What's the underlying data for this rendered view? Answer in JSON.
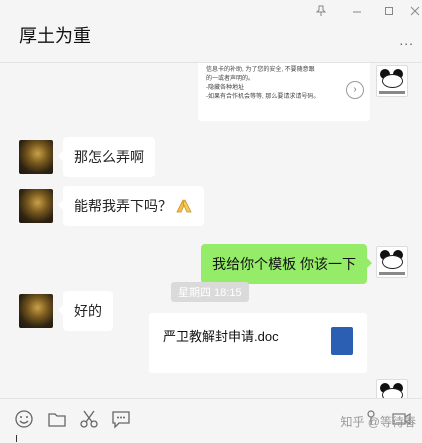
{
  "header": {
    "title": "厚土为重",
    "more_label": "..."
  },
  "messages": {
    "image_card_lines": [
      "信息卡的补助, 为了您的安全, 不要随意跟",
      "的一或者声明的。",
      "-隐藏各种地址",
      "-如果有合作机会等等, 那么要请求请号码。"
    ],
    "image_card_arrow": "›",
    "m1": "那怎么弄啊",
    "m2": "能帮我弄下吗？",
    "m3": "我给你个模板 你该一下",
    "m4": "好的",
    "timestamp": "星期四 18:15",
    "file_name": "严卫教解封申请.doc"
  },
  "toolbar": {
    "watermark": "知乎 @等待春"
  },
  "colors": {
    "sent_bubble": "#95ec69",
    "received_bubble": "#ffffff",
    "background": "#f5f5f5"
  }
}
